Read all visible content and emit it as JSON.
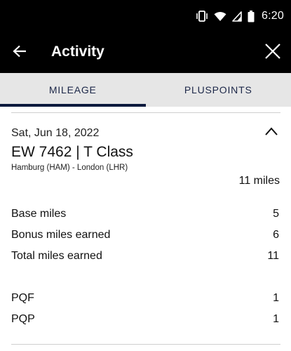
{
  "status_bar": {
    "time": "6:20",
    "icons": [
      "vibrate-icon",
      "wifi-icon",
      "cell-signal-icon",
      "battery-icon"
    ]
  },
  "app_bar": {
    "title": "Activity",
    "back_icon": "arrow-left-icon",
    "close_icon": "close-icon"
  },
  "tabs": [
    {
      "label": "MILEAGE",
      "active": true
    },
    {
      "label": "PLUSPOINTS",
      "active": false
    }
  ],
  "activity": {
    "date": "Sat, Jun 18, 2022",
    "flight": "EW 7462 | T Class",
    "route": "Hamburg (HAM) - London (LHR)",
    "total": "11 miles",
    "expand_icon": "chevron-up-icon",
    "rows": [
      {
        "label": "Base miles",
        "value": "5"
      },
      {
        "label": "Bonus miles earned",
        "value": "6"
      },
      {
        "label": "Total miles earned",
        "value": "11"
      },
      {
        "label": "PQF",
        "value": "1"
      },
      {
        "label": "PQP",
        "value": "1"
      }
    ]
  },
  "colors": {
    "app_bar_bg": "#000000",
    "tab_bar_bg": "#e6e6e6",
    "tab_indicator": "#0b1a3d",
    "tab_text": "#1c2748"
  }
}
